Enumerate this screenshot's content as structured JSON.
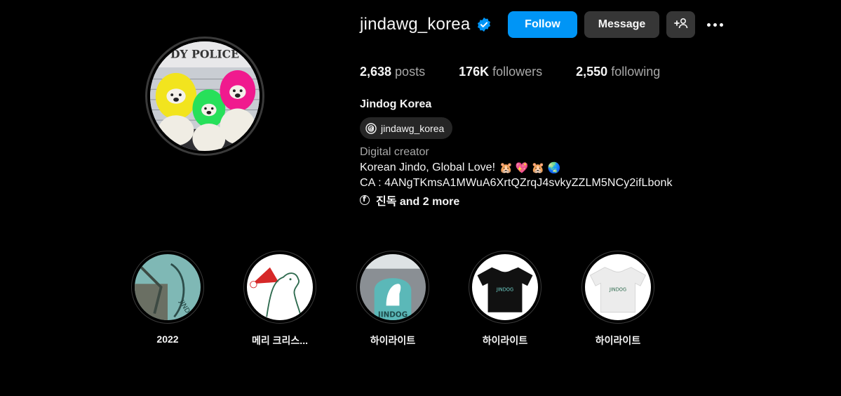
{
  "profile": {
    "username": "jindawg_korea",
    "verified": true,
    "full_name": "Jindog Korea",
    "threads_handle": "jindawg_korea",
    "category": "Digital creator",
    "bio_line1": "Korean Jindo, Global Love!",
    "bio_emojis": "🐹 💖 🐹 🌏",
    "bio_line2": "CA : 4ANgTKmsA1MWuA6XrtQZrqJ4svkyZZLM5NCy2ifLbonk",
    "links_text": "진독 and 2 more",
    "avatar_sign_text": "DY POLICE"
  },
  "actions": {
    "follow_label": "Follow",
    "message_label": "Message"
  },
  "stats": {
    "posts_count": "2,638",
    "posts_label": "posts",
    "followers_count": "176K",
    "followers_label": "followers",
    "following_count": "2,550",
    "following_label": "following"
  },
  "highlights": [
    {
      "label": "2022"
    },
    {
      "label": "메리 크리스..."
    },
    {
      "label": "하이라이트"
    },
    {
      "label": "하이라이트"
    },
    {
      "label": "하이라이트"
    }
  ],
  "colors": {
    "accent": "#0095f6",
    "background": "#000000",
    "secondary_button": "#363636",
    "muted_text": "#a8a8a8"
  },
  "icons": [
    "verified-badge-icon",
    "add-user-icon",
    "more-options-icon",
    "threads-icon",
    "facebook-icon"
  ]
}
